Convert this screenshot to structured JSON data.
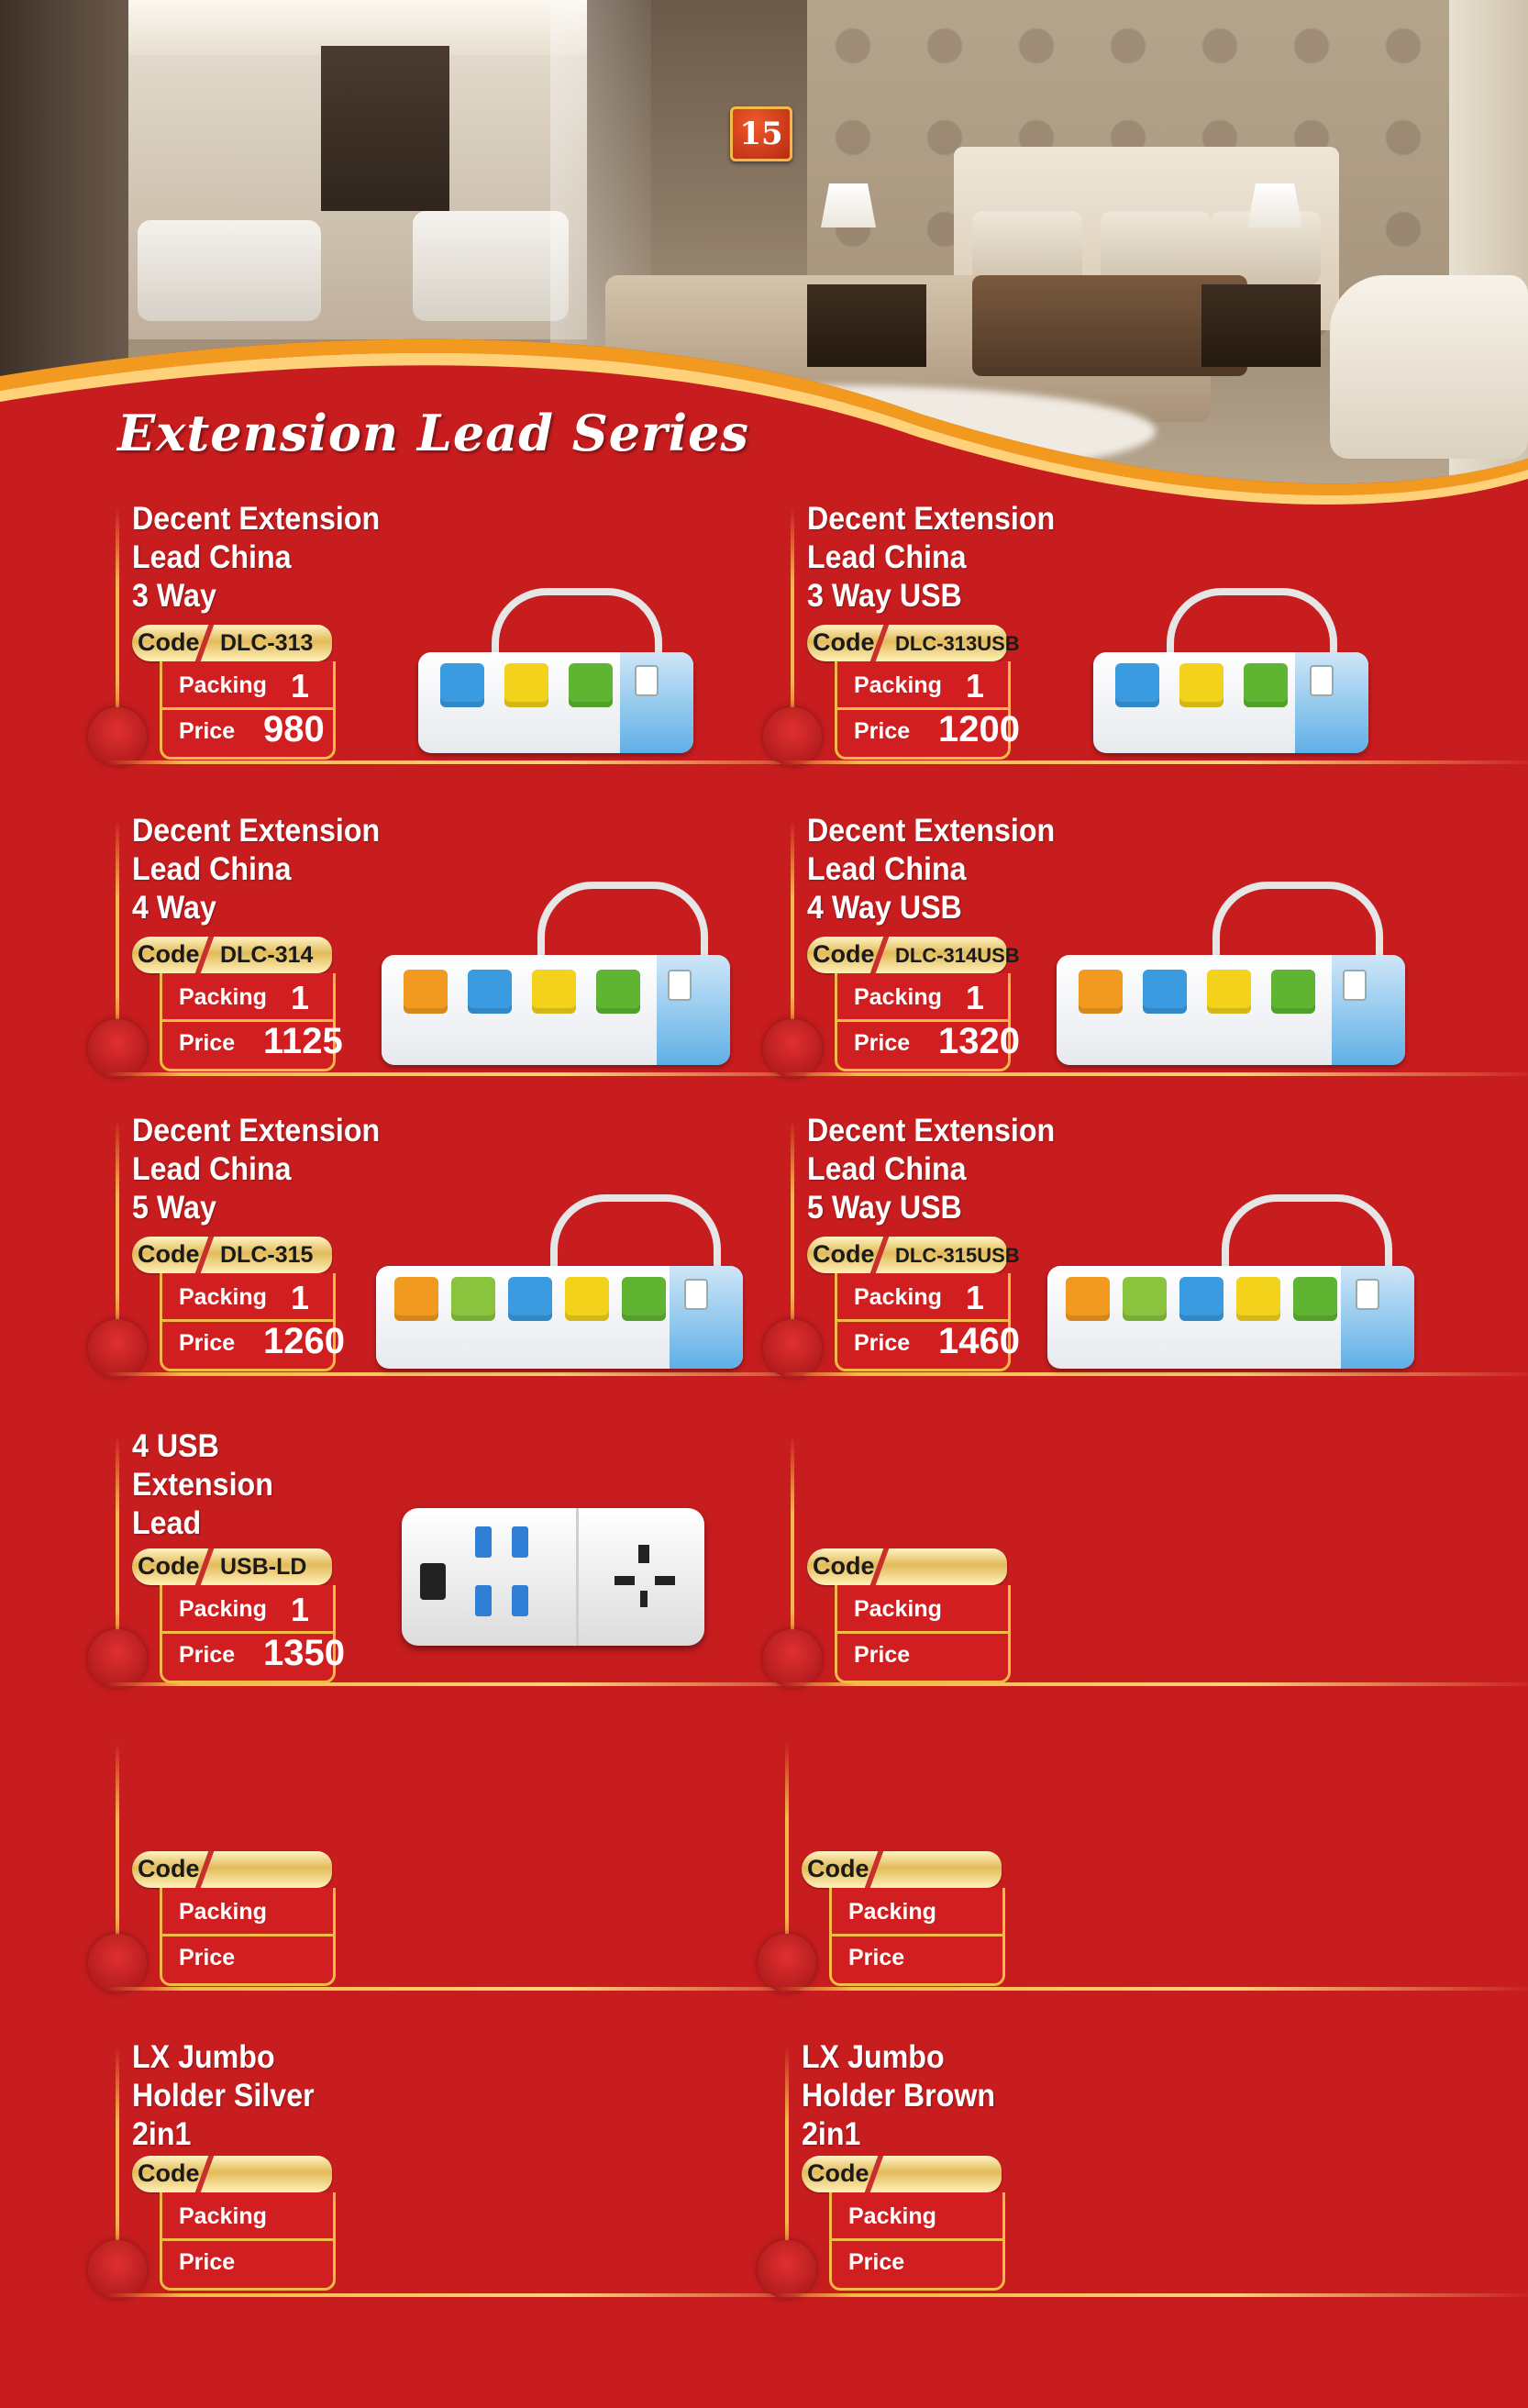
{
  "page": {
    "number": "15",
    "series_title": "Extension Lead Series"
  },
  "labels": {
    "code": "Code",
    "packing": "Packing",
    "price": "Price"
  },
  "products": [
    {
      "name": "Decent Extension\nLead China\n3 Way",
      "code": "DLC-313",
      "packing": "1",
      "price": "980"
    },
    {
      "name": "Decent Extension\nLead China\n3 Way USB",
      "code": "DLC-313USB",
      "packing": "1",
      "price": "1200"
    },
    {
      "name": "Decent Extension\nLead China\n4 Way",
      "code": "DLC-314",
      "packing": "1",
      "price": "1125"
    },
    {
      "name": "Decent Extension\nLead China\n4 Way USB",
      "code": "DLC-314USB",
      "packing": "1",
      "price": "1320"
    },
    {
      "name": "Decent Extension\nLead China\n5 Way",
      "code": "DLC-315",
      "packing": "1",
      "price": "1260"
    },
    {
      "name": "Decent Extension\nLead China\n5 Way USB",
      "code": "DLC-315USB",
      "packing": "1",
      "price": "1460"
    },
    {
      "name": "4 USB\nExtension\nLead",
      "code": "USB-LD",
      "packing": "1",
      "price": "1350"
    },
    {
      "name": "",
      "code": "",
      "packing": "",
      "price": ""
    },
    {
      "name": "",
      "code": "",
      "packing": "",
      "price": ""
    },
    {
      "name": "",
      "code": "",
      "packing": "",
      "price": ""
    },
    {
      "name": "LX Jumbo\nHolder Silver\n2in1",
      "code": "",
      "packing": "",
      "price": ""
    },
    {
      "name": "LX Jumbo\nHolder Brown\n2in1",
      "code": "",
      "packing": "",
      "price": ""
    }
  ],
  "colors": {
    "background": "#c81d1f",
    "gold": "#f5b946",
    "socket_blue": "#3a9be0",
    "socket_yellow": "#f2d21b",
    "socket_green": "#5fb532",
    "socket_orange": "#f29a1f"
  }
}
